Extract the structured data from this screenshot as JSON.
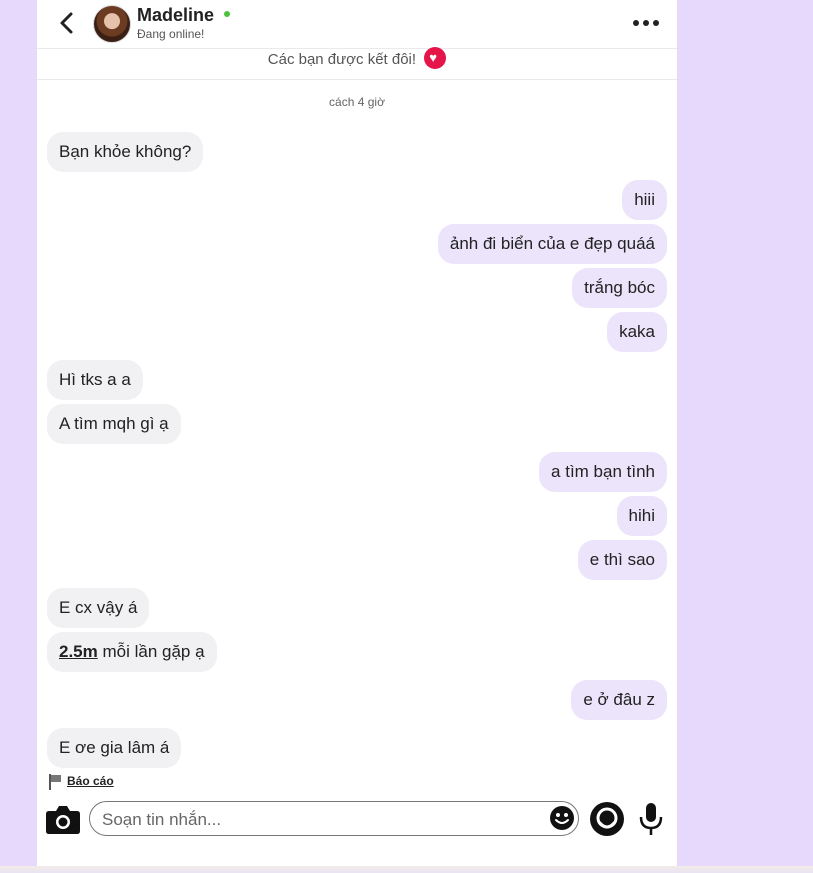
{
  "header": {
    "name": "Madeline",
    "status": "Đang online!",
    "online_color": "#4cc13d"
  },
  "match_banner": {
    "text": "Các bạn được kết đôi!"
  },
  "time_label": "cách 4 giờ",
  "messages": [
    {
      "from": "them",
      "text": "Bạn khỏe không?"
    },
    {
      "from": "me",
      "text": "hiii"
    },
    {
      "from": "me",
      "text": "ảnh đi biển của e đẹp quáá"
    },
    {
      "from": "me",
      "text": "trắng bóc"
    },
    {
      "from": "me",
      "text": "kaka"
    },
    {
      "from": "them",
      "text": "Hì tks a a"
    },
    {
      "from": "them",
      "text": "A tìm mqh gì ạ"
    },
    {
      "from": "me",
      "text": "a tìm bạn tình"
    },
    {
      "from": "me",
      "text": "hihi"
    },
    {
      "from": "me",
      "text": "e thì sao"
    },
    {
      "from": "them",
      "text": "E cx vậy á"
    },
    {
      "from": "them",
      "link_text": "2.5m",
      "text": " mỗi lần gặp ạ"
    },
    {
      "from": "me",
      "text": "e ở đâu z"
    },
    {
      "from": "them",
      "text": "E ơe gia lâm á"
    }
  ],
  "report_label": "Báo cáo",
  "composer": {
    "placeholder": "Soạn tin nhắn..."
  },
  "icons": {
    "back": "chevron-left-icon",
    "more": "more-dots-icon",
    "match": "heart-icon",
    "camera": "camera-icon",
    "emoji": "emoji-icon",
    "gif": "gif-sticker-icon",
    "mic": "microphone-icon",
    "report": "flag-icon"
  },
  "colors": {
    "page_bg": "#e6d9fb",
    "bubble_in": "#f1f0f3",
    "bubble_out": "#ece4fb",
    "accent_heart": "#e5154a"
  }
}
